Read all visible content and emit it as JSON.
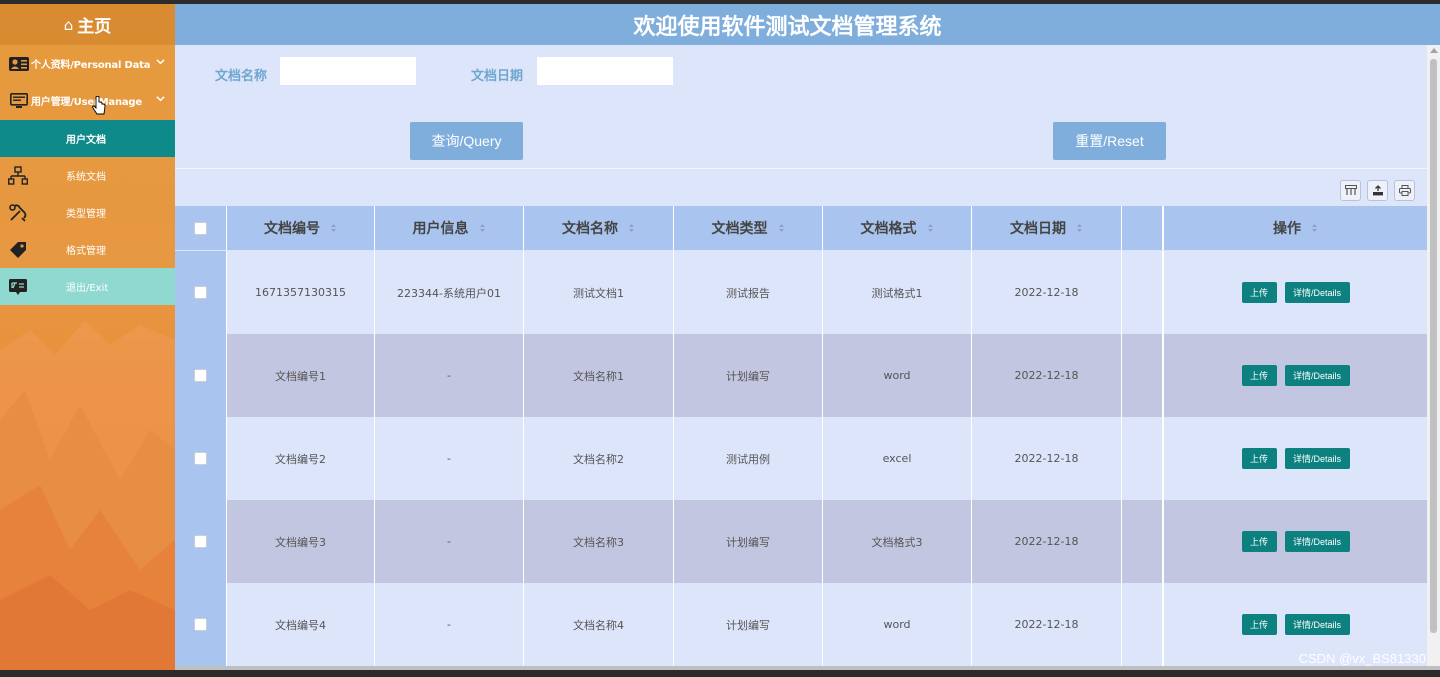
{
  "sidebar": {
    "home_label": "主页",
    "items": [
      {
        "label": "个人资料/Personal Data",
        "icon": "id-card-icon"
      },
      {
        "label": "用户管理/UserManage",
        "icon": "monitor-icon"
      }
    ],
    "sub_items": [
      {
        "label": "用户文档",
        "active": true
      },
      {
        "label": "系统文档",
        "icon": "hierarchy-icon"
      },
      {
        "label": "类型管理",
        "icon": "tools-icon"
      },
      {
        "label": "格式管理",
        "icon": "tag-icon"
      },
      {
        "label": "退出/Exit",
        "icon": "translate-icon"
      }
    ]
  },
  "header": {
    "title": "欢迎使用软件测试文档管理系统"
  },
  "search": {
    "name_label": "文档名称",
    "date_label": "文档日期",
    "query_button": "查询/Query",
    "reset_button": "重置/Reset"
  },
  "table": {
    "columns": [
      "文档编号",
      "用户信息",
      "文档名称",
      "文档类型",
      "文档格式",
      "文档日期",
      "操作"
    ],
    "rows": [
      {
        "id": "1671357130315",
        "user": "223344-系统用户01",
        "name": "测试文档1",
        "type": "测试报告",
        "format": "测试格式1",
        "date": "2022-12-18"
      },
      {
        "id": "文档编号1",
        "user": "-",
        "name": "文档名称1",
        "type": "计划编写",
        "format": "word",
        "date": "2022-12-18"
      },
      {
        "id": "文档编号2",
        "user": "-",
        "name": "文档名称2",
        "type": "测试用例",
        "format": "excel",
        "date": "2022-12-18"
      },
      {
        "id": "文档编号3",
        "user": "-",
        "name": "文档名称3",
        "type": "计划编写",
        "format": "文档格式3",
        "date": "2022-12-18"
      },
      {
        "id": "文档编号4",
        "user": "-",
        "name": "文档名称4",
        "type": "计划编写",
        "format": "word",
        "date": "2022-12-18"
      }
    ],
    "upload_label": "上传",
    "details_label": "详情/Details"
  },
  "watermark": "CSDN @vx_BS81330",
  "colors": {
    "header": "#7faedc",
    "sidebar": "#e79842",
    "active": "#0f8a8b",
    "teal_button": "#0d8080"
  }
}
